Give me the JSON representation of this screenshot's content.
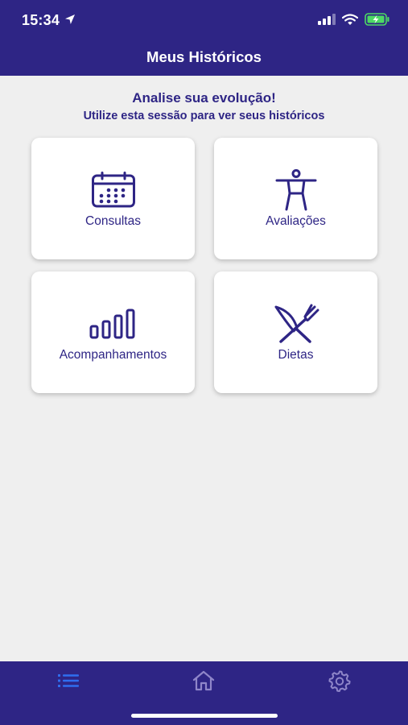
{
  "status_bar": {
    "time": "15:34",
    "icons": [
      "location-arrow-icon",
      "cellular-signal-icon",
      "wifi-icon",
      "battery-charging-icon"
    ]
  },
  "header": {
    "title": "Meus Históricos"
  },
  "intro": {
    "title": "Analise sua evolução!",
    "subtitle": "Utilize esta sessão para ver seus históricos"
  },
  "cards": [
    {
      "label": "Consultas",
      "icon": "calendar-icon"
    },
    {
      "label": "Avaliações",
      "icon": "body-figure-icon"
    },
    {
      "label": "Acompanhamentos",
      "icon": "bar-chart-icon"
    },
    {
      "label": "Dietas",
      "icon": "fork-knife-icon"
    }
  ],
  "tab_bar": {
    "tabs": [
      {
        "icon": "list-icon",
        "active": true
      },
      {
        "icon": "home-icon",
        "active": false
      },
      {
        "icon": "gear-icon",
        "active": false
      }
    ]
  },
  "colors": {
    "brand": "#2e2585",
    "background": "#efefef",
    "active_tab": "#2f6ef0",
    "inactive_tab": "#8f86c9",
    "battery": "#4cd964"
  }
}
